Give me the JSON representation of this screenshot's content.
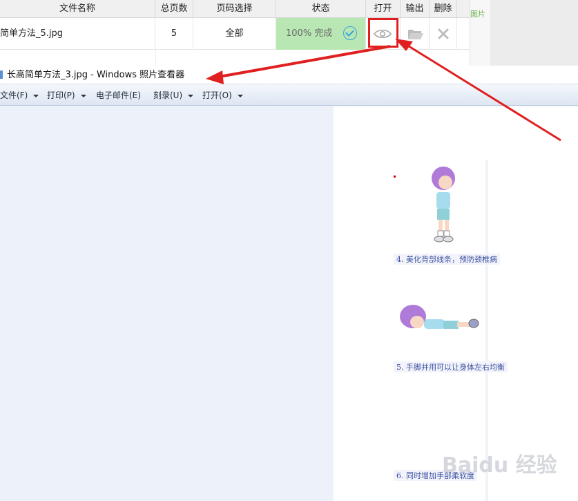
{
  "converter": {
    "headers": [
      "文件名称",
      "总页数",
      "页码选择",
      "状态",
      "打开",
      "输出",
      "删除"
    ],
    "row": {
      "filename": "简单方法_5.jpg",
      "pages": "5",
      "range": "全部",
      "status": "100% 完成"
    },
    "side_label": "图片"
  },
  "viewer": {
    "title": "长高简单方法_3.jpg - Windows 照片查看器",
    "menu": [
      {
        "label": "文件(F)"
      },
      {
        "label": "打印(P)"
      },
      {
        "label": "电子邮件(E)"
      },
      {
        "label": "刻录(U)"
      },
      {
        "label": "打开(O)"
      }
    ],
    "captions": [
      "4. 美化背部线条，预防颈椎病",
      "5. 手脚并用可以让身体左右均衡",
      "6. 同时增加手部柔软度"
    ]
  },
  "watermark": "Baidu 经验",
  "colors": {
    "status_bg": "#b9e7b4",
    "highlight": "#e02020",
    "caption_text": "#3a4fa0"
  },
  "icons": [
    "eye-icon",
    "folder-icon",
    "close-icon",
    "check-circle-icon"
  ]
}
